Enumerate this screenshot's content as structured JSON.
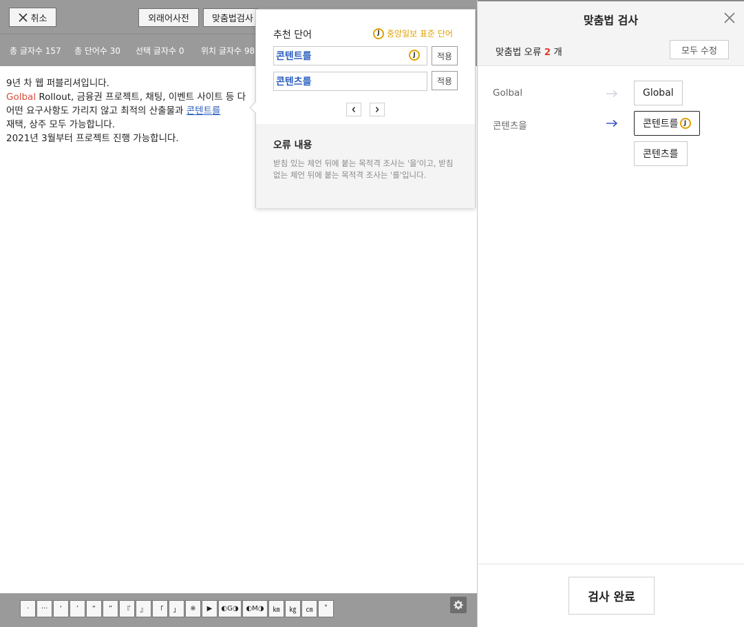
{
  "editor": {
    "toolbar": {
      "cancel_label": "취소",
      "dictionary_label": "외래어사전",
      "spellcheck_label": "맞춤법검사"
    },
    "stats": {
      "total_chars": "총 글자수 157",
      "total_words": "총 단어수 30",
      "selected_chars": "선택 글자수 0",
      "position_chars": "위치 글자수 98"
    },
    "lines": {
      "l1": " 9년 차 웹 퍼블리셔입니다.",
      "l2_err": "Golbal",
      "l2_rest": " Rollout, 금융권 프로젝트, 채팅, 이벤트 사이트 등 다",
      "l3_pre": "어떤 요구사항도 가리지 않고 최적의 산출물과 ",
      "l3_sel": "콘텐트를",
      "l4": "재택, 상주 모두 가능합니다.",
      "l5": "2021년 3월부터 프로젝트 진행 가능합니다."
    },
    "symbols": [
      "·",
      "···",
      "‘",
      "’",
      "“",
      "”",
      "『",
      "』",
      "「",
      "」",
      "※",
      "▶",
      "◐G◑",
      "◐M◑",
      "㎞",
      "㎏",
      "㎝",
      "˚"
    ]
  },
  "popover": {
    "title": "추천 단어",
    "standard_label": "중앙일보 표준 단어",
    "badge_letter": "J",
    "suggestions": [
      "콘텐트를",
      "콘텐츠를"
    ],
    "apply_label": "적용",
    "info_title": "오류 내용",
    "info_desc": "받침 있는 체언 뒤에 붙는 목적격 조사는 '을'이고, 받침 없는 체언 뒤에 붙는 목적격 조사는 '를'입니다."
  },
  "panel": {
    "title": "맞춤법 검사",
    "error_prefix": "맞춤법 오류",
    "error_count": "2",
    "error_suffix": "개",
    "fix_all_label": "모두 수정",
    "corrections": [
      {
        "original": "Golbal",
        "fix": "Global"
      },
      {
        "original": "콘텐츠을",
        "fix": "콘텐트를",
        "fix2": "콘텐츠를"
      }
    ],
    "done_label": "검사 완료"
  },
  "colors": {
    "error_text": "#d94b3a",
    "link_blue": "#2c5fbf",
    "badge_gold": "#e0a100",
    "error_count_red": "#e03a2a"
  }
}
